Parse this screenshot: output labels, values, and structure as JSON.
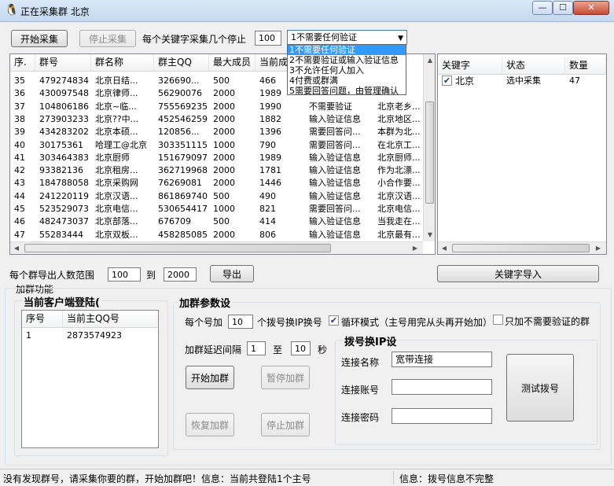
{
  "window": {
    "title": "正在采集群  北京",
    "min_glyph": "—",
    "max_glyph": "☐",
    "close_glyph": "✕"
  },
  "toolbar": {
    "start_collect": "开始采集",
    "stop_collect": "停止采集",
    "stop_after_label": "每个关键字采集几个停止",
    "stop_after_value": "100",
    "verify_select_value": "1不需要任何验证"
  },
  "verify_options": [
    "1不需要任何验证",
    "2不需要验证或输入验证信息",
    "3不允许任何人加入",
    "4付费或群满",
    "5需要回答问题，由管理确认"
  ],
  "group_table": {
    "columns": [
      "序.",
      "群号",
      "群名称",
      "群主QQ",
      "最大成员",
      "当前成"
    ],
    "rows": [
      [
        "35",
        "479274834",
        "北京日结...",
        "326690...",
        "500",
        "466",
        "",
        "请..."
      ],
      [
        "36",
        "430097548",
        "北京律师...",
        "56290076",
        "2000",
        "1989",
        "",
        ""
      ],
      [
        "37",
        "104806186",
        "北京~临...",
        "755569235",
        "2000",
        "1990",
        "不需要验证",
        "北京老乡..."
      ],
      [
        "38",
        "273903233",
        "北京??中...",
        "452546259",
        "2000",
        "1882",
        "输入验证信息",
        "北京地区..."
      ],
      [
        "39",
        "434283202",
        "北京本硕...",
        "120856...",
        "2000",
        "1396",
        "需要回答问...",
        "本群为北..."
      ],
      [
        "40",
        "30175361",
        "哈理工@北京",
        "303351115",
        "1000",
        "790",
        "需要回答问...",
        "在北京工..."
      ],
      [
        "41",
        "303464383",
        "北京厨师",
        "151679097",
        "2000",
        "1989",
        "输入验证信息",
        "北京厨师..."
      ],
      [
        "42",
        "93382136",
        "北京租房...",
        "362719968",
        "2000",
        "1781",
        "输入验证信息",
        "作为北漂..."
      ],
      [
        "43",
        "184788058",
        "北京采购网",
        "76269081",
        "2000",
        "1446",
        "输入验证信息",
        "小合作要..."
      ],
      [
        "44",
        "241220119",
        "北京汉语...",
        "861869740",
        "500",
        "490",
        "输入验证信息",
        "北京汉语..."
      ],
      [
        "45",
        "523529073",
        "北京电信...",
        "530654417",
        "1000",
        "821",
        "需要回答问...",
        "北京电信..."
      ],
      [
        "46",
        "482473037",
        "北京部落...",
        "676709",
        "500",
        "414",
        "输入验证信息",
        "当我走在..."
      ],
      [
        "47",
        "55283444",
        "北京双板...",
        "458285085",
        "2000",
        "806",
        "输入验证信息",
        "北京最有..."
      ]
    ]
  },
  "keyword_table": {
    "columns": [
      "关键字",
      "状态",
      "数量"
    ],
    "rows": [
      {
        "keyword": "北京",
        "checked": true,
        "status": "选中采集",
        "count": "47"
      }
    ]
  },
  "export": {
    "range_label": "每个群导出人数范围",
    "min": "100",
    "to_label": "到",
    "max": "2000",
    "export_btn": "导出",
    "keyword_import_btn": "关键字导入"
  },
  "add_group": {
    "section_label": "加群功能",
    "client_group_label": "当前客户端登陆(",
    "client_columns": [
      "序号",
      "当前主QQ号"
    ],
    "client_rows": [
      [
        "1",
        "2873574923"
      ]
    ],
    "params_label": "加群参数设",
    "per_label": "每个号加",
    "per_value": "10",
    "per_suffix": "个拨号换IP换号",
    "loop_mode_checked": true,
    "loop_mode_label": "循环模式（主号用完从头再开始加）",
    "only_no_verify_checked": false,
    "only_no_verify_label": "只加不需要验证的群",
    "delay_label": "加群延迟间隔",
    "delay_min": "1",
    "delay_to": "至",
    "delay_max": "10",
    "delay_unit": "秒",
    "start_btn": "开始加群",
    "pause_btn": "暂停加群",
    "resume_btn": "恢复加群",
    "stop_btn": "停止加群"
  },
  "dialer": {
    "label": "拨号换IP设",
    "conn_name_label": "连接名称",
    "conn_name_value": "宽带连接",
    "account_label": "连接账号",
    "account_value": "",
    "password_label": "连接密码",
    "password_value": "",
    "test_btn": "测试拨号"
  },
  "status": {
    "left": "没有发现群号，请采集你要的群，开始加群吧！信息：当前共登陆1个主号",
    "right": "信息：拨号信息不完整"
  }
}
